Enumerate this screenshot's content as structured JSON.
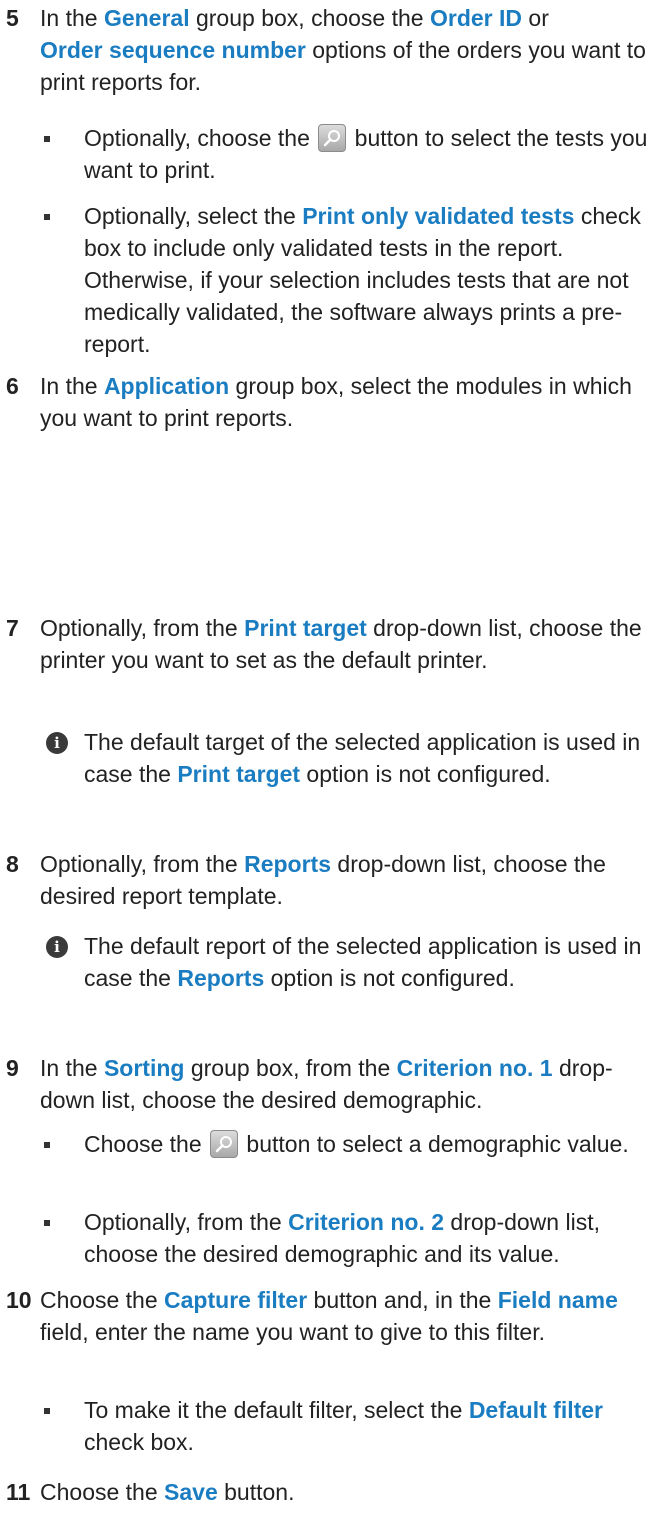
{
  "steps": {
    "s5": {
      "num": "5",
      "t1": "In the ",
      "k1": "General",
      "t2": " group box, choose the ",
      "k2": "Order ID",
      "t3": " or",
      "k3": "Order sequence number",
      "t4": " options of the orders you want to print reports for.",
      "b1": {
        "t1": "Optionally, choose the ",
        "t2": " button to select the tests you want to print."
      },
      "b2": {
        "t1": "Optionally, select the ",
        "k1": "Print only validated tests",
        "t2": " check box to include only validated tests in the report. Otherwise, if your selection includes tests that are not medically validated, the software always prints a pre-report."
      }
    },
    "s6": {
      "num": "6",
      "t1": "In the ",
      "k1": "Application",
      "t2": " group box, select the modules in which you want to print reports."
    },
    "s7": {
      "num": "7",
      "t1": "Optionally, from the ",
      "k1": "Print target",
      "t2": " drop-down list, choose the printer you want to set as the default printer.",
      "note": {
        "t1": "The default target of the selected application is used in case the ",
        "k1": "Print target",
        "t2": " option is not configured."
      }
    },
    "s8": {
      "num": "8",
      "t1": "Optionally, from the ",
      "k1": "Reports",
      "t2": " drop-down list, choose the desired report template.",
      "note": {
        "t1": "The default report of the selected application is used in case the ",
        "k1": "Reports",
        "t2": " option is not configured."
      }
    },
    "s9": {
      "num": "9",
      "t1": "In the ",
      "k1": "Sorting",
      "t2": " group box, from the ",
      "k2": "Criterion no. 1",
      "t3": " drop-down list, choose the desired demographic.",
      "b1": {
        "t1": "Choose the ",
        "t2": " button to select a demographic value."
      },
      "b2": {
        "t1": "Optionally, from the ",
        "k1": "Criterion no. 2",
        "t2": " drop-down list, choose the desired demographic and its value."
      }
    },
    "s10": {
      "num": "10",
      "t1": "Choose the ",
      "k1": "Capture filter",
      "t2": " button and, in the ",
      "k2": "Field name",
      "t3": " field, enter the name you want to give to this filter.",
      "b1": {
        "t1": "To make it the default filter, select the ",
        "k1": "Default filter",
        "t2": " check box."
      }
    },
    "s11": {
      "num": "11",
      "t1": "Choose the ",
      "k1": "Save",
      "t2": " button."
    }
  },
  "icons": {
    "search_button": "magnifier-icon",
    "info": "info-icon"
  },
  "colors": {
    "keyword": "#1a7cc1",
    "text": "#222222"
  }
}
